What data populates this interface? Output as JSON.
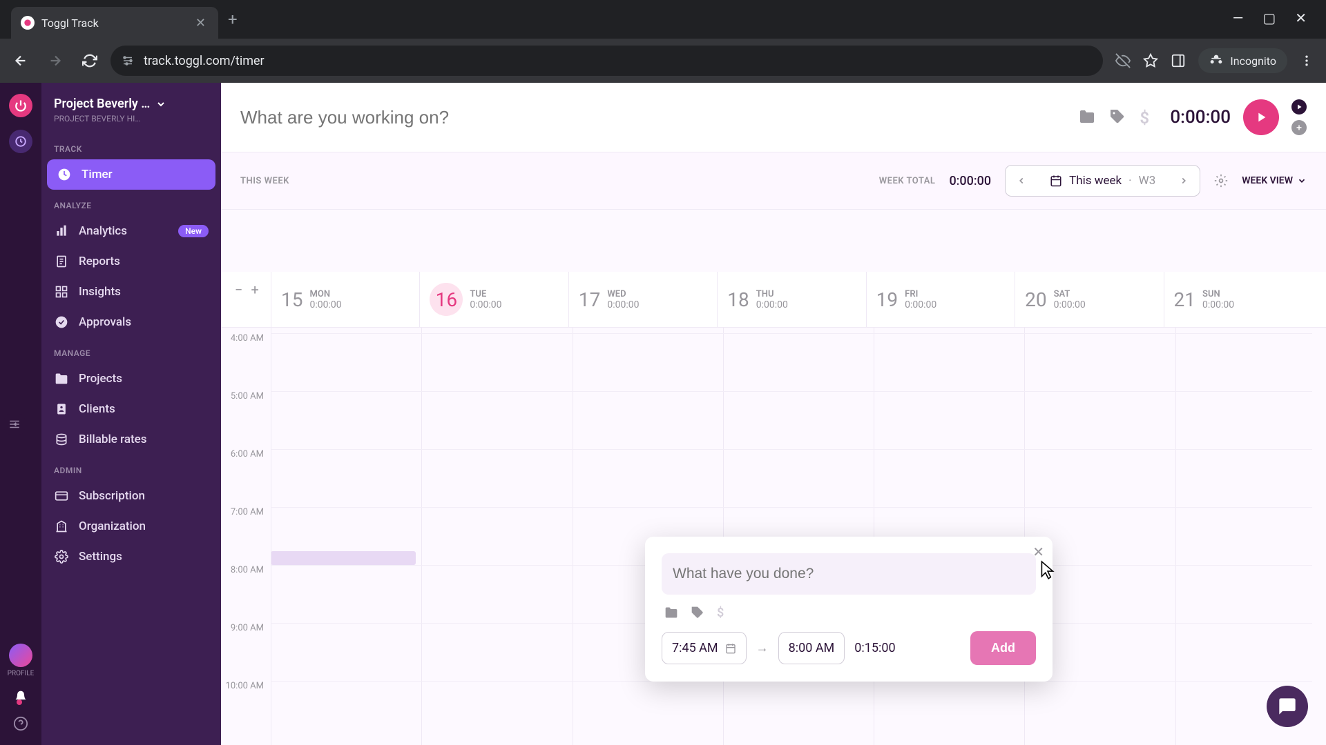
{
  "browser": {
    "tab_title": "Toggl Track",
    "url": "track.toggl.com/timer",
    "incognito_label": "Incognito"
  },
  "workspace": {
    "name": "Project Beverly …",
    "sub": "PROJECT BEVERLY HI…"
  },
  "sidebar": {
    "sections": {
      "track": "TRACK",
      "analyze": "ANALYZE",
      "manage": "MANAGE",
      "admin": "ADMIN"
    },
    "items": {
      "timer": "Timer",
      "analytics": "Analytics",
      "analytics_badge": "New",
      "reports": "Reports",
      "insights": "Insights",
      "approvals": "Approvals",
      "projects": "Projects",
      "clients": "Clients",
      "billable": "Billable rates",
      "subscription": "Subscription",
      "organization": "Organization",
      "settings": "Settings"
    },
    "profile_label": "PROFILE"
  },
  "timer_bar": {
    "placeholder": "What are you working on?",
    "value": "0:00:00"
  },
  "week_header": {
    "this_week_label": "THIS WEEK",
    "total_label": "WEEK TOTAL",
    "total_value": "0:00:00",
    "range_text": "This week",
    "range_week": "W3",
    "view_label": "WEEK VIEW"
  },
  "days": [
    {
      "num": "15",
      "abbr": "MON",
      "time": "0:00:00",
      "today": false
    },
    {
      "num": "16",
      "abbr": "TUE",
      "time": "0:00:00",
      "today": true
    },
    {
      "num": "17",
      "abbr": "WED",
      "time": "0:00:00",
      "today": false
    },
    {
      "num": "18",
      "abbr": "THU",
      "time": "0:00:00",
      "today": false
    },
    {
      "num": "19",
      "abbr": "FRI",
      "time": "0:00:00",
      "today": false
    },
    {
      "num": "20",
      "abbr": "SAT",
      "time": "0:00:00",
      "today": false
    },
    {
      "num": "21",
      "abbr": "SUN",
      "time": "0:00:00",
      "today": false
    }
  ],
  "time_labels": [
    "4:00 AM",
    "5:00 AM",
    "6:00 AM",
    "7:00 AM",
    "8:00 AM",
    "9:00 AM",
    "10:00 AM"
  ],
  "popup": {
    "placeholder": "What have you done?",
    "start": "7:45 AM",
    "end": "8:00 AM",
    "duration": "0:15:00",
    "add_label": "Add"
  }
}
